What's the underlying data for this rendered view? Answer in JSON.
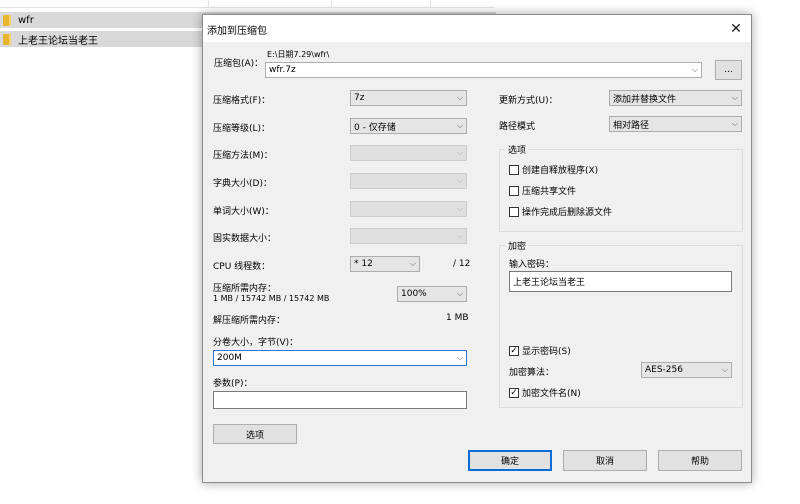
{
  "explorer": {
    "files": [
      {
        "name": "wfr",
        "selected": true
      },
      {
        "name": "上老王论坛当老王",
        "selected": true
      }
    ]
  },
  "dialog": {
    "title": "添加到压缩包",
    "close": "✕",
    "archive": {
      "label": "压缩包(A)：",
      "path": "E:\\日期7.29\\wfr\\",
      "value": "wfr.7z",
      "browse": "..."
    },
    "left": {
      "format_label": "压缩格式(F)：",
      "format_value": "7z",
      "level_label": "压缩等级(L)：",
      "level_value": "0 - 仅存储",
      "method_label": "压缩方法(M)：",
      "dict_label": "字典大小(D)：",
      "word_label": "单词大小(W)：",
      "solid_label": "固实数据大小：",
      "cpu_label": "CPU 线程数：",
      "cpu_value": "* 12",
      "cpu_max": "/ 12",
      "mem_comp_label": "压缩所需内存：",
      "mem_comp_detail": "1 MB / 15742 MB / 15742 MB",
      "mem_percent": "100%",
      "mem_decomp_label": "解压缩所需内存：",
      "mem_decomp_value": "1 MB",
      "split_label": "分卷大小，字节(V)：",
      "split_value": "200M",
      "params_label": "参数(P)：",
      "params_value": "",
      "options_button": "选项"
    },
    "right": {
      "update_label": "更新方式(U)：",
      "update_value": "添加并替换文件",
      "path_label": "路径模式",
      "path_value": "相对路径",
      "options_group": "选项",
      "opt_sfx": "创建自释放程序(X)",
      "opt_shared": "压缩共享文件",
      "opt_delete": "操作完成后删除源文件",
      "encrypt_group": "加密",
      "password_label": "输入密码：",
      "password_value": "上老王论坛当老王",
      "show_password": "显示密码(S)",
      "algo_label": "加密算法：",
      "algo_value": "AES-256",
      "encrypt_names": "加密文件名(N)"
    },
    "buttons": {
      "ok": "确定",
      "cancel": "取消",
      "help": "帮助"
    },
    "arrow": "⌵",
    "check": "✓"
  }
}
